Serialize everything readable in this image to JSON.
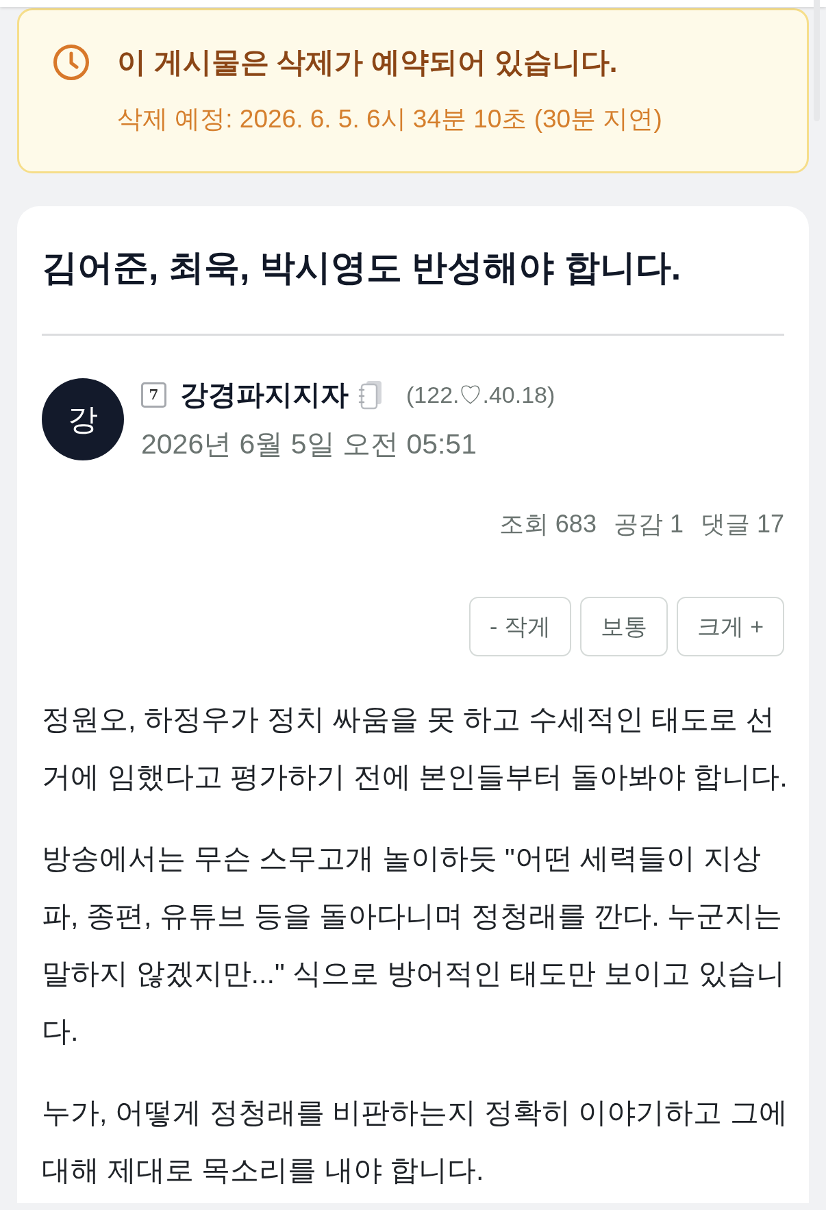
{
  "notice": {
    "title": "이 게시물은 삭제가 예약되어 있습니다.",
    "schedule": "삭제 예정: 2026. 6. 5. 6시 34분 10초 (30분 지연)"
  },
  "post": {
    "title": "김어준, 최욱, 박시영도 반성해야 합니다.",
    "author": {
      "initial": "강",
      "badge": "7",
      "name": "강경파지지자",
      "ip": "(122.♡.40.18)",
      "date": "2026년 6월 5일 오전 05:51"
    },
    "stats": [
      "조회 683",
      "공감 1",
      "댓글 17"
    ],
    "size_buttons": [
      "- 작게",
      "보통",
      "크게 +"
    ],
    "paragraphs": [
      "정원오, 하정우가 정치 싸움을 못 하고 수세적인 태도로 선거에 임했다고 평가하기 전에 본인들부터 돌아봐야 합니다.",
      "방송에서는 무슨 스무고개 놀이하듯 \"어떤 세력들이 지상파, 종편, 유튜브 등을 돌아다니며 정청래를 깐다. 누군지는 말하지 않겠지만...\" 식으로 방어적인 태도만 보이고 있습니다.",
      "누가, 어떻게 정청래를 비판하는지 정확히 이야기하고 그에 대해 제대로 목소리를 내야 합니다."
    ]
  }
}
